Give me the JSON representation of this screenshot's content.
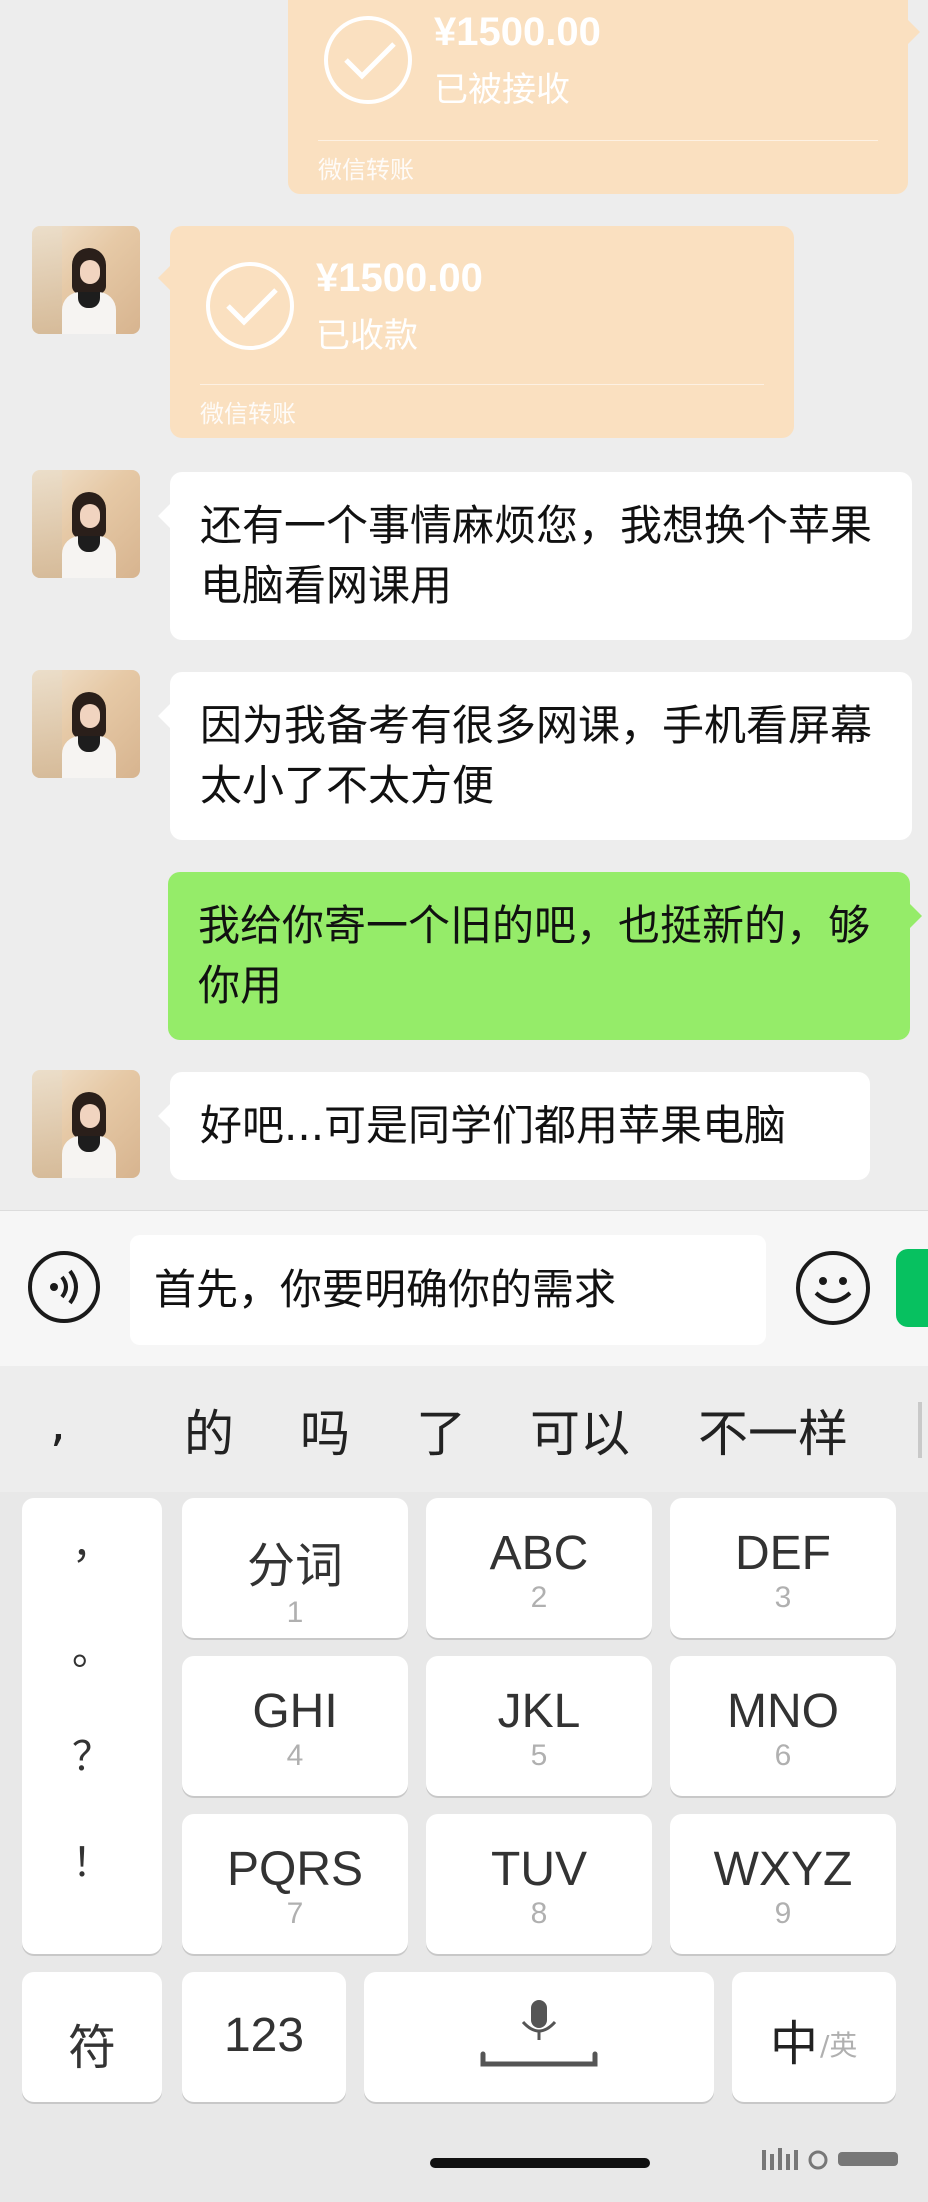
{
  "chat": {
    "transfers": [
      {
        "amount": "¥1500.00",
        "status": "已被接收",
        "source": "微信转账"
      },
      {
        "amount": "¥1500.00",
        "status": "已收款",
        "source": "微信转账"
      }
    ],
    "messages": [
      {
        "text": "还有一个事情麻烦您，我想换个苹果电脑看网课用"
      },
      {
        "text": "因为我备考有很多网课，手机看屏幕太小了不太方便"
      },
      {
        "text": "我给你寄一个旧的吧，也挺新的，够你用"
      },
      {
        "text": "好吧...可是同学们都用苹果电脑"
      }
    ]
  },
  "input_bar": {
    "text": "首先，你要明确你的需求",
    "send_color": "#07c160"
  },
  "candidates": [
    ",",
    "的",
    "吗",
    "了",
    "可以",
    "不一样"
  ],
  "keyboard": {
    "punctuation": [
      "，",
      "。",
      "？",
      "！"
    ],
    "keys": [
      {
        "label": "分词",
        "sub": "1"
      },
      {
        "label": "ABC",
        "sub": "2"
      },
      {
        "label": "DEF",
        "sub": "3"
      },
      {
        "label": "GHI",
        "sub": "4"
      },
      {
        "label": "JKL",
        "sub": "5"
      },
      {
        "label": "MNO",
        "sub": "6"
      },
      {
        "label": "PQRS",
        "sub": "7"
      },
      {
        "label": "TUV",
        "sub": "8"
      },
      {
        "label": "WXYZ",
        "sub": "9"
      }
    ],
    "symbols_label": "符",
    "numbers_label": "123",
    "lang_main": "中",
    "lang_alt": "/英"
  },
  "colors": {
    "chat_bg": "#ededed",
    "transfer_bubble": "#fae0c0",
    "sent_bubble": "#95ec69",
    "received_bubble": "#ffffff"
  }
}
